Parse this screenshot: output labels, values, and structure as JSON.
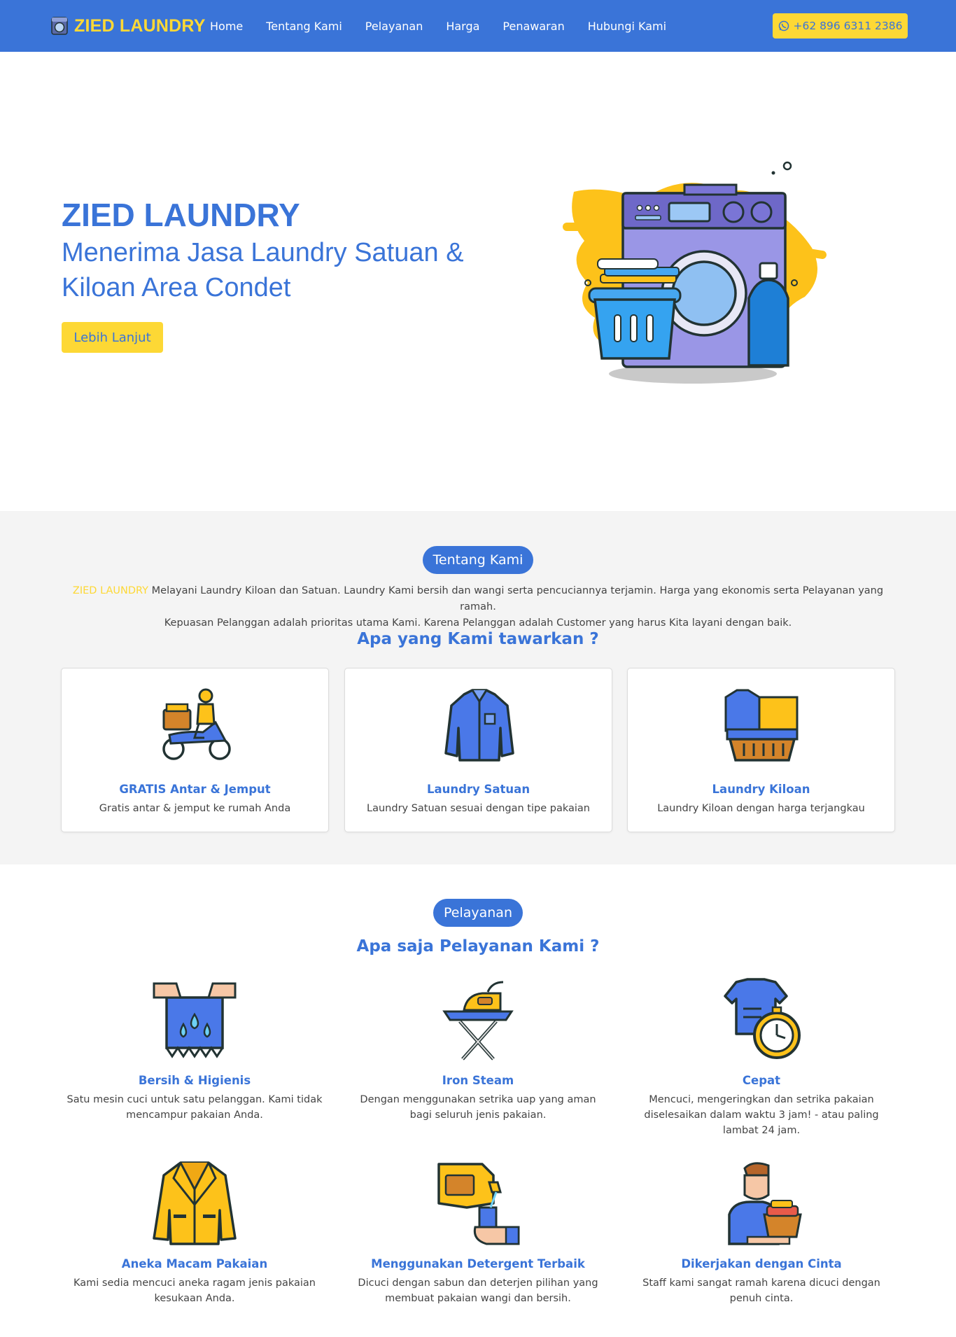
{
  "nav": {
    "brand": "ZIED LAUNDRY",
    "links": [
      "Home",
      "Tentang Kami",
      "Pelayanan",
      "Harga",
      "Penawaran",
      "Hubungi Kami"
    ],
    "phone": "+62 896 6311 2386"
  },
  "hero": {
    "title": "ZIED LAUNDRY",
    "subtitle": "Menerima Jasa Laundry Satuan & Kiloan Area Condet",
    "button": "Lebih Lanjut"
  },
  "about": {
    "badge": "Tentang Kami",
    "brand_highlight": "ZIED LAUNDRY",
    "text_line1": " Melayani Laundry Kiloan dan Satuan. Laundry Kami bersih dan wangi serta pencuciannya terjamin. Harga yang ekonomis serta Pelayanan yang ramah.",
    "text_line2": "Kepuasan Pelanggan adalah prioritas utama Kami. Karena Pelanggan adalah Customer yang harus Kita layani dengan baik.",
    "offer_heading": "Apa yang Kami tawarkan ?",
    "cards": [
      {
        "title": "GRATIS Antar & Jemput",
        "desc": "Gratis antar & jemput ke rumah Anda",
        "icon": "delivery-scooter-icon"
      },
      {
        "title": "Laundry Satuan",
        "desc": "Laundry Satuan sesuai dengan tipe pakaian",
        "icon": "shirt-icon"
      },
      {
        "title": "Laundry Kiloan",
        "desc": "Laundry Kiloan dengan harga terjangkau",
        "icon": "laundry-basket-icon"
      }
    ]
  },
  "services": {
    "badge": "Pelayanan",
    "heading": "Apa saja Pelayanan Kami ?",
    "items": [
      {
        "title": "Bersih & Higienis",
        "desc": "Satu mesin cuci untuk satu pelanggan. Kami tidak mencampur pakaian Anda.",
        "icon": "clean-cloth-icon"
      },
      {
        "title": "Iron Steam",
        "desc": "Dengan menggunakan setrika uap yang aman bagi seluruh jenis pakaian.",
        "icon": "ironing-board-icon"
      },
      {
        "title": "Cepat",
        "desc": "Mencuci, mengeringkan dan setrika pakaian diselesaikan dalam waktu 3 jam! - atau paling lambat 24 jam.",
        "icon": "stopwatch-shirt-icon"
      },
      {
        "title": "Aneka Macam Pakaian",
        "desc": "Kami sedia mencuci aneka ragam jenis pakaian kesukaan Anda.",
        "icon": "jacket-icon"
      },
      {
        "title": "Menggunakan Detergent Terbaik",
        "desc": "Dicuci dengan sabun dan deterjen pilihan yang membuat pakaian wangi dan bersih.",
        "icon": "detergent-pour-icon"
      },
      {
        "title": "Dikerjakan dengan Cinta",
        "desc": "Staff kami sangat ramah karena dicuci dengan penuh cinta.",
        "icon": "staff-with-basket-icon"
      }
    ]
  },
  "colors": {
    "primary": "#3a74d8",
    "accent": "#fdd835",
    "section_bg": "#f4f4f4"
  }
}
